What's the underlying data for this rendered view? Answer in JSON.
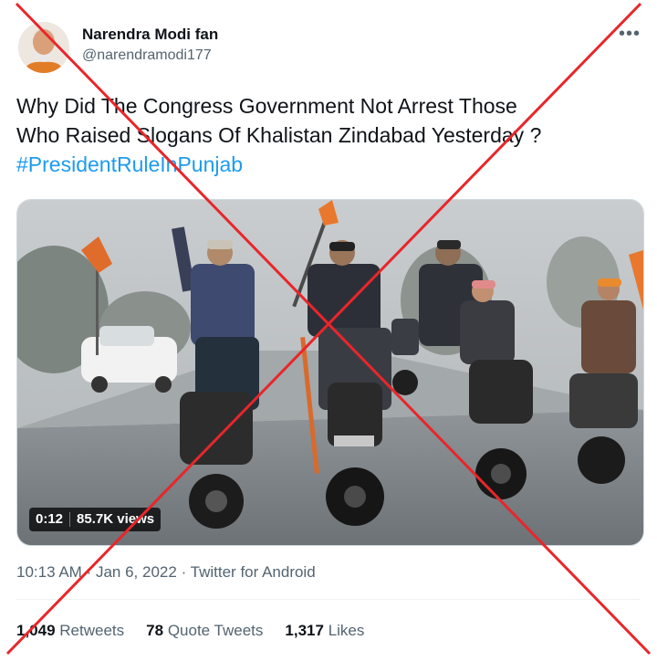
{
  "author": {
    "name": "Narendra Modi fan",
    "handle": "@narendramodi177"
  },
  "more_icon": "more-horizontal-icon",
  "tweet": {
    "line1": "Why Did The Congress Government Not Arrest Those",
    "line2": "Who Raised Slogans Of Khalistan Zindabad Yesterday ?",
    "hashtag": "#PresidentRuleInPunjab"
  },
  "video": {
    "duration": "0:12",
    "views": "85.7K views"
  },
  "meta": {
    "time": "10:13 AM",
    "dot1": "·",
    "date": "Jan 6, 2022",
    "dot2": "·",
    "source": "Twitter for Android"
  },
  "stats": {
    "retweets_count": "1,049",
    "retweets_label": "Retweets",
    "quotes_count": "78",
    "quotes_label": "Quote Tweets",
    "likes_count": "1,317",
    "likes_label": "Likes"
  },
  "colors": {
    "link": "#1d9bf0",
    "muted": "#536471",
    "cross": "#e8262a"
  }
}
